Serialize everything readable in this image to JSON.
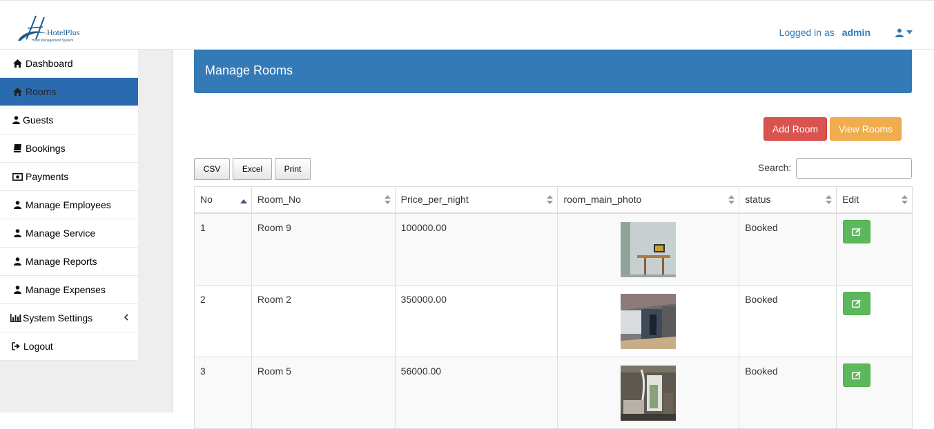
{
  "brand": {
    "logo_title": "HotelPlus",
    "logo_subtitle": "Hotel Management System"
  },
  "header": {
    "logged_in_label": "Logged in as",
    "username": "admin",
    "user_icon": "user-icon",
    "caret_icon": "caret-down-icon"
  },
  "sidebar": {
    "items": [
      {
        "label": "Dashboard",
        "icon": "home-icon"
      },
      {
        "label": "Rooms",
        "icon": "home-icon"
      },
      {
        "label": "Guests",
        "icon": "user-icon"
      },
      {
        "label": "Bookings",
        "icon": "book-icon"
      },
      {
        "label": "Payments",
        "icon": "money-icon"
      },
      {
        "label": "Manage Employees",
        "icon": "user-icon"
      },
      {
        "label": "Manage Service",
        "icon": "user-icon"
      },
      {
        "label": "Manage Reports",
        "icon": "user-icon"
      },
      {
        "label": "Manage Expenses",
        "icon": "user-icon"
      },
      {
        "label": "System Settings",
        "icon": "bar-chart-icon"
      },
      {
        "label": "Logout",
        "icon": "sign-out-icon"
      }
    ],
    "active_index": 1
  },
  "main": {
    "title": "Manage Rooms",
    "add_button": "Add Room",
    "view_button": "View Rooms",
    "export": {
      "csv": "CSV",
      "excel": "Excel",
      "print": "Print"
    },
    "search_label": "Search:",
    "search_value": ""
  },
  "table": {
    "columns": [
      "No",
      "Room_No",
      "Price_per_night",
      "room_main_photo",
      "status",
      "Edit"
    ],
    "rows": [
      {
        "no": "1",
        "room_no": "Room 9",
        "price": "100000.00",
        "status": "Booked"
      },
      {
        "no": "2",
        "room_no": "Room 2",
        "price": "350000.00",
        "status": "Booked"
      },
      {
        "no": "3",
        "room_no": "Room 5",
        "price": "56000.00",
        "status": "Booked"
      }
    ]
  },
  "colors": {
    "primary": "#337ab7",
    "sidebar_active": "#2a6bb0",
    "danger": "#d9534f",
    "warning": "#f0ad4e",
    "success": "#5cb85c"
  }
}
